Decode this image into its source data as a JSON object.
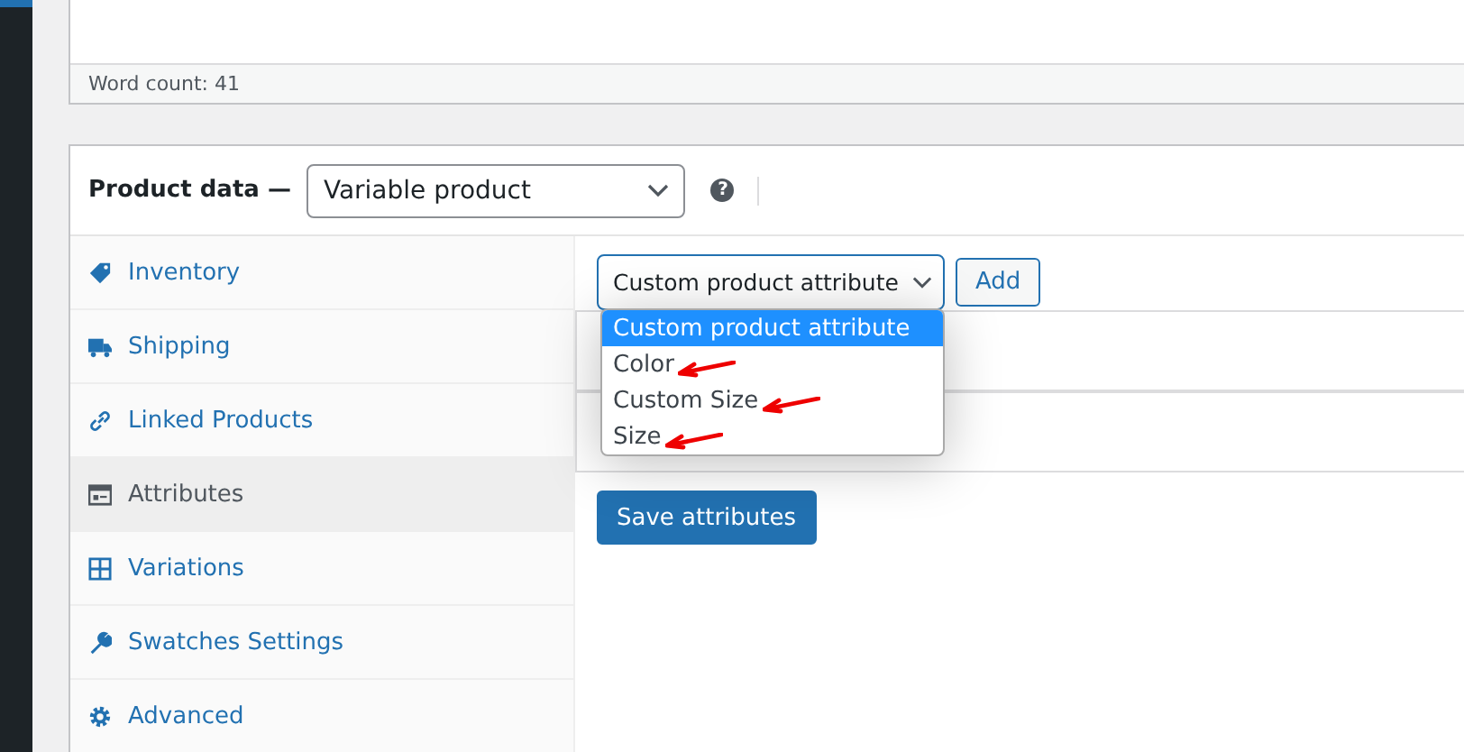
{
  "editor": {
    "word_count": "Word count: 41"
  },
  "product_data": {
    "label": "Product data —",
    "type_select": {
      "value": "Variable product"
    },
    "help": "?"
  },
  "tabs": [
    {
      "label": "Inventory",
      "selected": false
    },
    {
      "label": "Shipping",
      "selected": false
    },
    {
      "label": "Linked Products",
      "selected": false
    },
    {
      "label": "Attributes",
      "selected": true
    },
    {
      "label": "Variations",
      "selected": false
    },
    {
      "label": "Swatches Settings",
      "selected": false
    },
    {
      "label": "Advanced",
      "selected": false
    }
  ],
  "attribute_select": {
    "value": "Custom product attribute",
    "expanded": true,
    "options": [
      {
        "label": "Custom product attribute",
        "selected": true,
        "annotated": false
      },
      {
        "label": "Color",
        "selected": false,
        "annotated": true
      },
      {
        "label": "Custom Size",
        "selected": false,
        "annotated": true
      },
      {
        "label": "Size",
        "selected": false,
        "annotated": true
      }
    ]
  },
  "add_button": "Add",
  "save_button": "Save attributes"
}
